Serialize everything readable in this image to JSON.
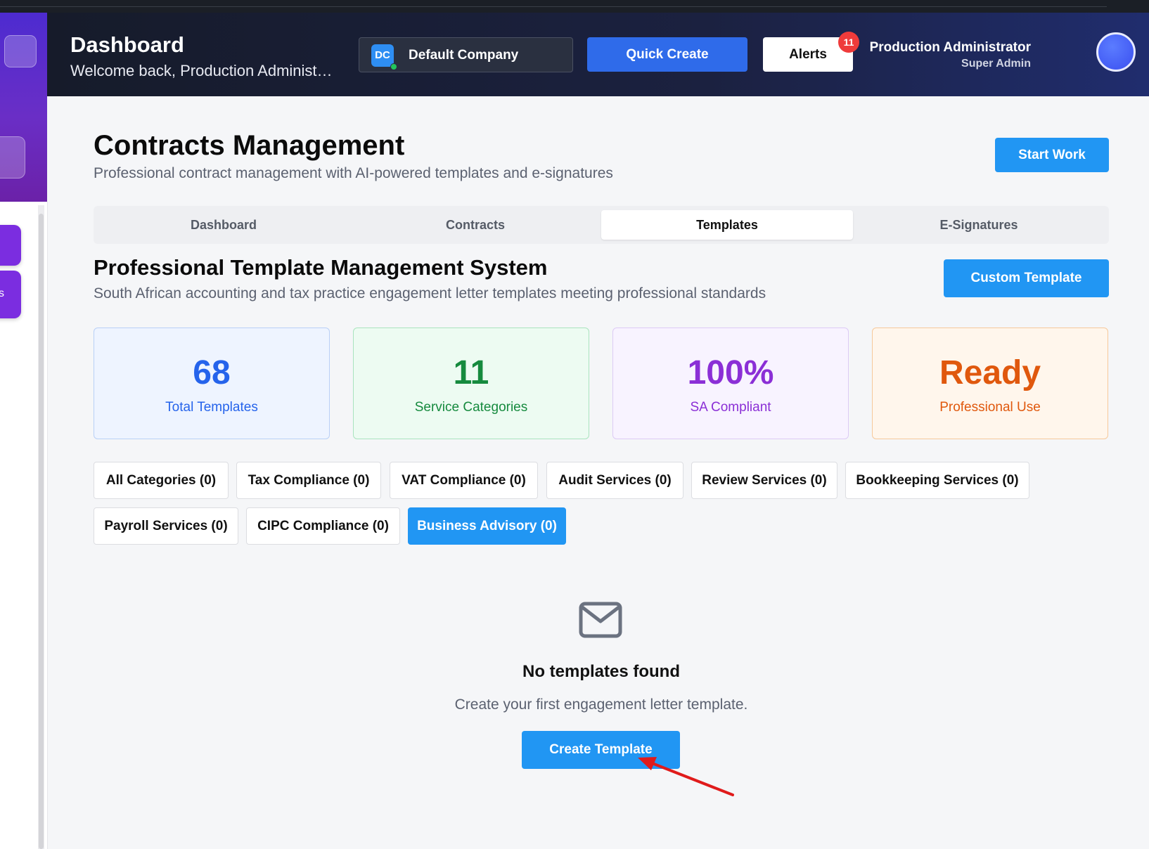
{
  "header": {
    "title": "Dashboard",
    "welcome": "Welcome back, Production Administra...",
    "company_initials": "DC",
    "company_name": "Default Company",
    "quick_create": "Quick Create",
    "alerts": "Alerts",
    "alerts_count": "11",
    "user_name": "Production Administrator",
    "user_role": "Super Admin"
  },
  "sidebar": {
    "partial_label": "s"
  },
  "page": {
    "title": "Contracts Management",
    "subtitle": "Professional contract management with AI-powered templates and e-signatures",
    "start_work": "Start Work"
  },
  "tabs": [
    {
      "label": "Dashboard",
      "active": false
    },
    {
      "label": "Contracts",
      "active": false
    },
    {
      "label": "Templates",
      "active": true
    },
    {
      "label": "E-Signatures",
      "active": false
    }
  ],
  "section": {
    "title": "Professional Template Management System",
    "subtitle": "South African accounting and tax practice engagement letter templates meeting professional standards",
    "custom_template": "Custom Template"
  },
  "stats": [
    {
      "value": "68",
      "label": "Total Templates",
      "color": "#2563eb"
    },
    {
      "value": "11",
      "label": "Service Categories",
      "color": "#168a3e"
    },
    {
      "value": "100%",
      "label": "SA Compliant",
      "color": "#8b2fd6"
    },
    {
      "value": "Ready",
      "label": "Professional Use",
      "color": "#e0580d"
    }
  ],
  "categories": [
    {
      "label": "All Categories (0)",
      "active": false
    },
    {
      "label": "Tax Compliance (0)",
      "active": false
    },
    {
      "label": "VAT Compliance (0)",
      "active": false
    },
    {
      "label": "Audit Services (0)",
      "active": false
    },
    {
      "label": "Review Services (0)",
      "active": false
    },
    {
      "label": "Bookkeeping Services (0)",
      "active": false
    },
    {
      "label": "Payroll Services (0)",
      "active": false
    },
    {
      "label": "CIPC Compliance (0)",
      "active": false
    },
    {
      "label": "Business Advisory (0)",
      "active": true
    }
  ],
  "empty": {
    "icon": "mail-icon",
    "title": "No templates found",
    "subtitle": "Create your first engagement letter template.",
    "create_button": "Create Template"
  },
  "colors": {
    "accent": "#2196f3",
    "header_bg": "#161b2a",
    "sidebar_purple": "#6a2ec6",
    "annotation_arrow": "#e01b1b"
  }
}
